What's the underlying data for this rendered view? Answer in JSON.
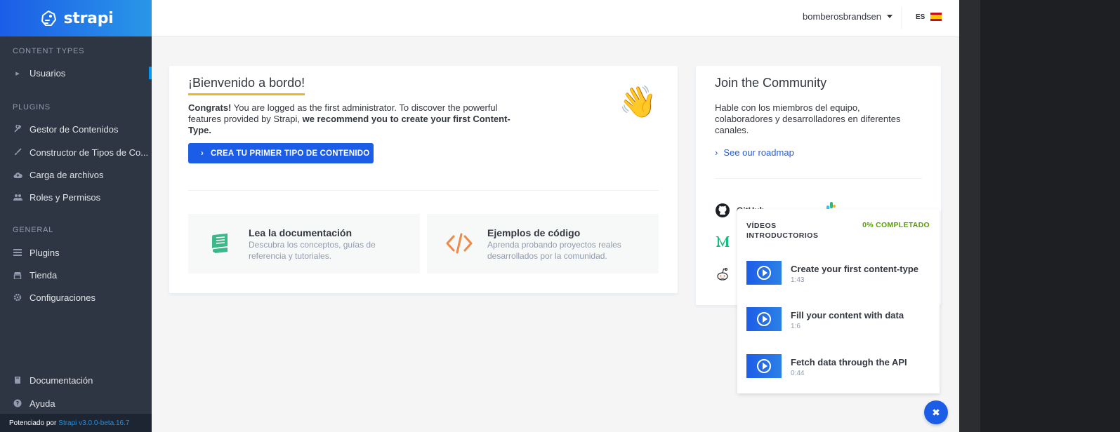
{
  "brand": {
    "name": "strapi",
    "logo_icon": "strapi-logo-icon"
  },
  "sidebar": {
    "content_types_title": "Content Types",
    "content_types": [
      {
        "label": "Usuarios",
        "icon": "caret-right-icon",
        "active": true
      }
    ],
    "plugins_title": "Plugins",
    "plugins": [
      {
        "label": "Gestor de Contenidos",
        "icon": "wrench-icon"
      },
      {
        "label": "Constructor de Tipos de Co...",
        "icon": "brush-icon"
      },
      {
        "label": "Carga de archivos",
        "icon": "cloud-upload-icon"
      },
      {
        "label": "Roles y Permisos",
        "icon": "users-icon"
      }
    ],
    "general_title": "General",
    "general": [
      {
        "label": "Plugins",
        "icon": "list-icon"
      },
      {
        "label": "Tienda",
        "icon": "shop-icon"
      },
      {
        "label": "Configuraciones",
        "icon": "gear-icon"
      }
    ],
    "bottom": [
      {
        "label": "Documentación",
        "icon": "book-icon"
      },
      {
        "label": "Ayuda",
        "icon": "question-icon"
      }
    ],
    "footer_prefix": "Potenciado por",
    "footer_version": "Strapi v3.0.0-beta.16.7"
  },
  "topbar": {
    "username": "bomberosbrandsen",
    "language": "ES"
  },
  "welcome": {
    "title": "¡Bienvenido a bordo!",
    "intro_bold": "Congrats!",
    "intro_text": " You are logged as the first administrator. To discover the powerful features provided by Strapi, ",
    "intro_strong": " we recommend you to create your first Content-Type.",
    "cta_label": "CREA TU PRIMER TIPO DE CONTENIDO",
    "features": [
      {
        "title": "Lea la documentación",
        "desc": "Descubra los conceptos, guías de referencia y tutoriales."
      },
      {
        "title": "Ejemplos de código",
        "desc": "Aprenda probando proyectos reales desarrollados por la comunidad."
      }
    ]
  },
  "community": {
    "title": "Join the Community",
    "desc": "Hable con los miembros del equipo, colaboradores y desarrolladores en diferentes canales.",
    "roadmap_label": "See our roadmap",
    "social_label": "GitHub"
  },
  "videos": {
    "title": "VÍDEOS INTRODUCTORIOS",
    "progress": "0% COMPLETADO",
    "items": [
      {
        "name": "Create your first content-type",
        "duration": "1:43"
      },
      {
        "name": "Fill your content with data",
        "duration": "1:6"
      },
      {
        "name": "Fetch data through the API",
        "duration": "0:44"
      }
    ]
  },
  "close_fab": "✖"
}
